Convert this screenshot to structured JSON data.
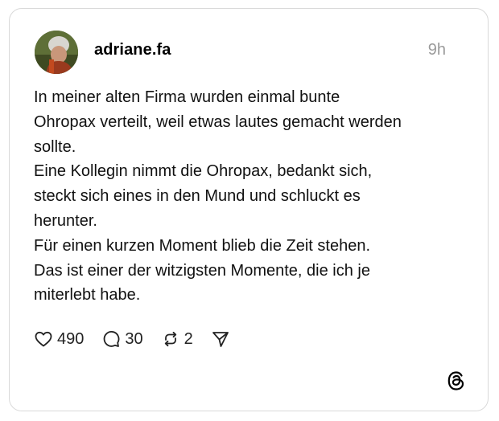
{
  "post": {
    "username": "adriane.fa",
    "timestamp": "9h",
    "text_lines": [
      "In meiner alten Firma wurden einmal bunte",
      "Ohropax verteilt, weil etwas lautes gemacht werden",
      "sollte.",
      "Eine Kollegin nimmt die Ohropax, bedankt sich,",
      "steckt sich eines in den Mund und schluckt es",
      "herunter.",
      "Für einen kurzen Moment blieb die Zeit stehen.",
      "Das ist einer der witzigsten Momente, die ich je",
      "miterlebt habe."
    ]
  },
  "actions": {
    "like_icon": "heart-icon",
    "like_count": "490",
    "reply_icon": "speech-bubble-icon",
    "reply_count": "30",
    "repost_icon": "repost-icon",
    "repost_count": "2",
    "share_icon": "paper-plane-icon"
  },
  "branding": {
    "logo_icon": "threads-logo-icon"
  },
  "colors": {
    "border": "#d9d9d9",
    "timestamp": "#9a9a9a",
    "text": "#111111"
  }
}
